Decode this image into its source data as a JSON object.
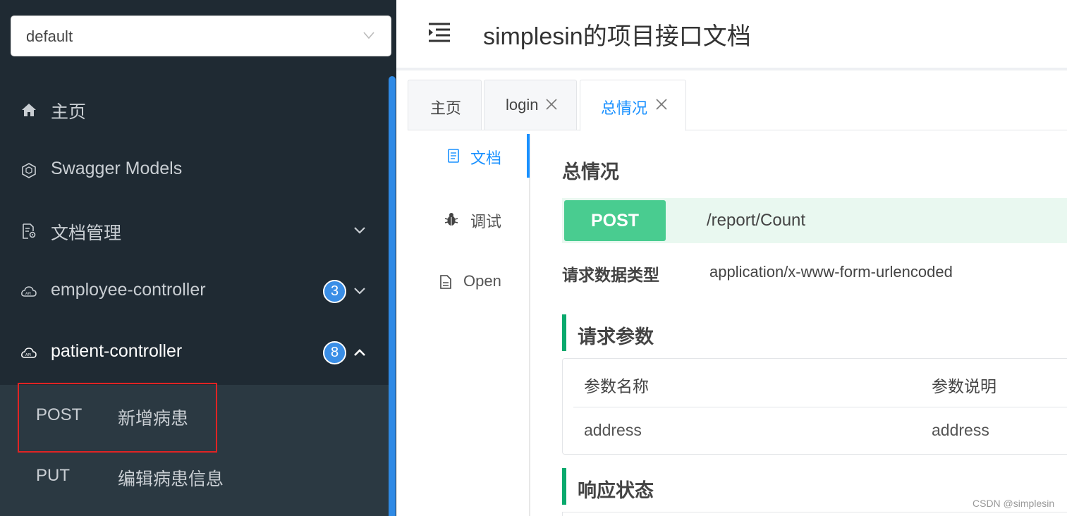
{
  "sidebar": {
    "group_select": {
      "value": "default"
    },
    "items": [
      {
        "label": "主页",
        "icon": "home-icon"
      },
      {
        "label": "Swagger Models",
        "icon": "swagger-models-icon"
      },
      {
        "label": "文档管理",
        "icon": "doc-settings-icon"
      },
      {
        "label": "employee-controller",
        "icon": "api-cloud-icon",
        "badge": "3"
      },
      {
        "label": "patient-controller",
        "icon": "api-cloud-icon",
        "badge": "8"
      }
    ],
    "submenu": [
      {
        "method": "POST",
        "name": "新增病患"
      },
      {
        "method": "PUT",
        "name": "编辑病患信息"
      }
    ]
  },
  "header": {
    "title": "simplesin的项目接口文档"
  },
  "tabs": [
    {
      "label": "主页"
    },
    {
      "label": "login"
    },
    {
      "label": "总情况"
    }
  ],
  "subnav": [
    {
      "label": "文档",
      "icon": "document-icon"
    },
    {
      "label": "调试",
      "icon": "bug-icon"
    },
    {
      "label": "Open",
      "icon": "file-icon"
    }
  ],
  "content": {
    "title": "总情况",
    "method": "POST",
    "path": "/report/Count",
    "request_type_label": "请求数据类型",
    "request_type_value": "application/x-www-form-urlencoded",
    "params_section": "请求参数",
    "param_headers": [
      "参数名称",
      "参数说明"
    ],
    "param_rows": [
      [
        "address",
        "address"
      ]
    ],
    "response_section": "响应状态"
  },
  "colors": {
    "sidebar_bg": "#1f2a33",
    "submenu_bg": "#2b3942",
    "accent_blue": "#1890ff",
    "post_green": "#49cc90",
    "section_green": "#0aa96d",
    "highlight_red": "#e02424"
  },
  "watermark": "CSDN @simplesin"
}
